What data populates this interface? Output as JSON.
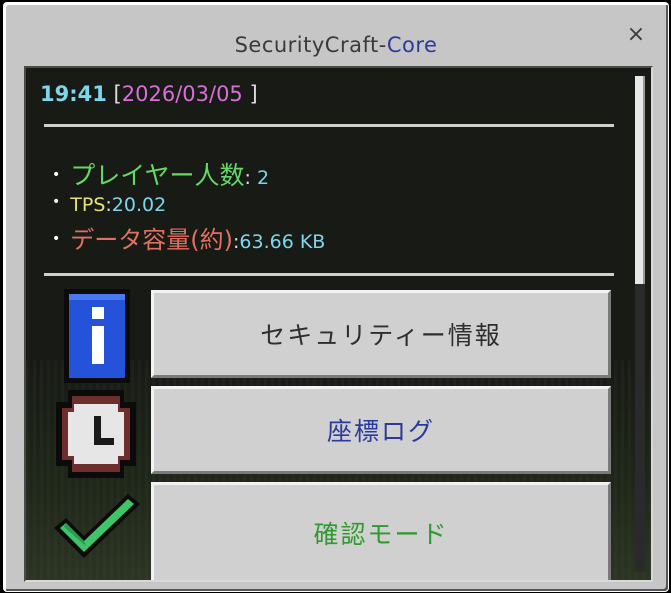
{
  "window": {
    "title_main": "SecurityCraft-",
    "title_accent": "Core",
    "close_glyph": "×"
  },
  "status": {
    "time": "19:41",
    "bracket_open": "[",
    "date": "2026/03/05",
    "bracket_close": "]"
  },
  "stats": {
    "bullet": "•",
    "players_label": "プレイヤー人数",
    "players_sep": ": ",
    "players_value": "2",
    "tps_label": "TPS",
    "tps_sep": ":",
    "tps_value": "20.02",
    "data_label": "データ容量(約)",
    "data_sep": ":",
    "data_value": "63.66 KB"
  },
  "menu": {
    "items": [
      {
        "label": "セキュリティー情報",
        "icon": "info-icon"
      },
      {
        "label": "座標ログ",
        "icon": "clock-icon"
      },
      {
        "label": "確認モード",
        "icon": "checkmark-icon"
      }
    ]
  },
  "colors": {
    "accent_blue": "#2b3a9b",
    "time_cyan": "#7fd6ea",
    "date_magenta": "#d86ed8",
    "players_green": "#66d866",
    "tps_yellow": "#e8e07a",
    "data_red": "#e07060",
    "confirm_green": "#2f9a2f"
  }
}
